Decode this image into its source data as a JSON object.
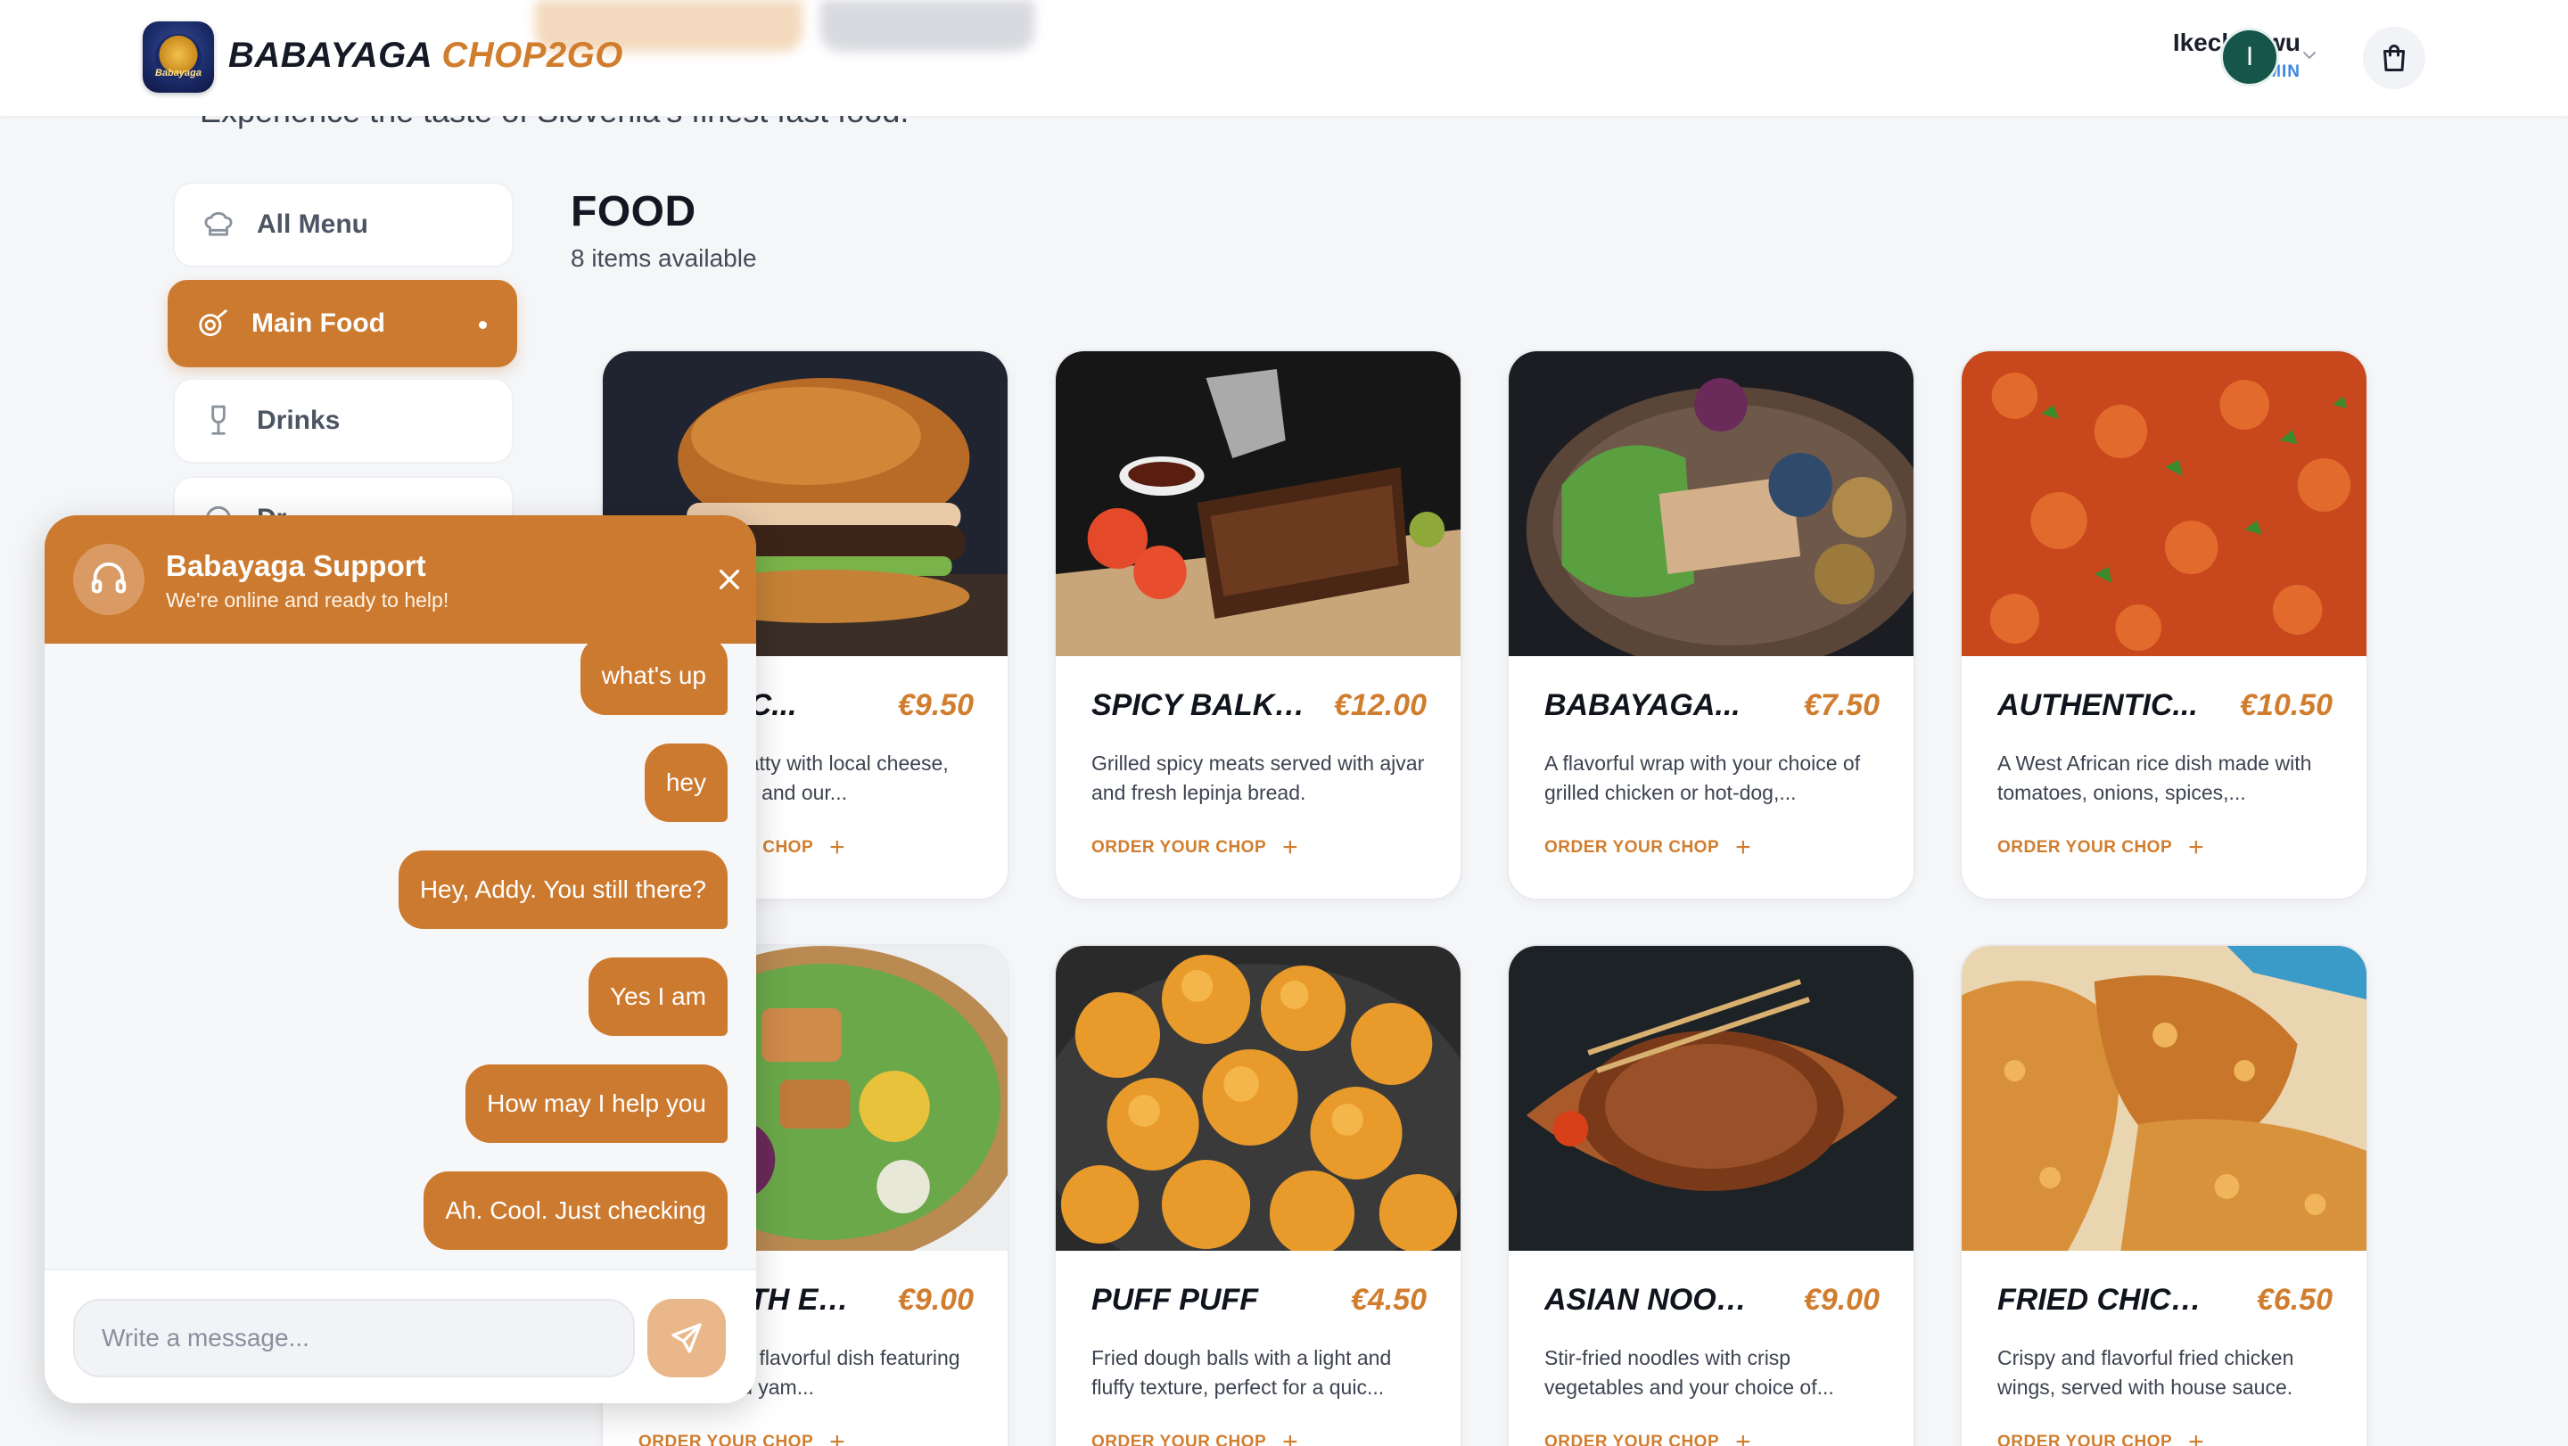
{
  "header": {
    "brand_part1": "BABAYAGA",
    "brand_part2": "CHOP2GO",
    "logo_text": "Babayaga",
    "user_name": "Ikechukwu",
    "user_role": "ADMIN",
    "avatar_initial": "I"
  },
  "tagline": "Experience the taste of Slovenia's finest fast food.",
  "sidebar": {
    "items": [
      {
        "label": "All Menu",
        "icon": "chef-hat-icon"
      },
      {
        "label": "Main Food",
        "icon": "food-icon",
        "active": true
      },
      {
        "label": "Drinks",
        "icon": "wine-glass-icon"
      },
      {
        "label": "Dr...",
        "icon": "dessert-icon"
      }
    ]
  },
  "section": {
    "title": "FOOD",
    "subtitle": "8 items available"
  },
  "order_label": "ORDER YOUR CHOP",
  "cards": [
    {
      "name": "CLASSIC...",
      "price": "€9.50",
      "desc": "Juicy beef patty with local cheese, fresh lettuce, and our..."
    },
    {
      "name": "SPICY BALKA...",
      "price": "€12.00",
      "desc": "Grilled spicy meats served with ajvar and fresh lepinja bread."
    },
    {
      "name": "BABAYAGA...",
      "price": "€7.50",
      "desc": "A flavorful wrap with your choice of grilled chicken or hot-dog,..."
    },
    {
      "name": "AUTHENTIC...",
      "price": "€10.50",
      "desc": "A West African rice dish made with tomatoes, onions, spices,..."
    },
    {
      "name": "YAM WITH EGG...",
      "price": "€9.00",
      "desc": "A hearty and flavorful dish featuring sweet boiled yam..."
    },
    {
      "name": "PUFF PUFF",
      "price": "€4.50",
      "desc": "Fried dough balls with a light and fluffy texture, perfect for a quic..."
    },
    {
      "name": "ASIAN NOODL...",
      "price": "€9.00",
      "desc": "Stir-fried noodles with crisp vegetables and your choice of..."
    },
    {
      "name": "FRIED CHICKE...",
      "price": "€6.50",
      "desc": "Crispy and flavorful fried chicken wings, served with house sauce."
    }
  ],
  "chat": {
    "title": "Babayaga Support",
    "subtitle": "We're online and ready to help!",
    "messages": [
      "what's up",
      "hey",
      "Hey, Addy. You still there?",
      "Yes I am",
      "How may I help you",
      "Ah. Cool. Just checking"
    ],
    "input_placeholder": "Write a message..."
  },
  "colors": {
    "accent": "#cc7a2f",
    "price": "#d17d2e",
    "admin": "#3a86e0",
    "avatar": "#15554a"
  }
}
